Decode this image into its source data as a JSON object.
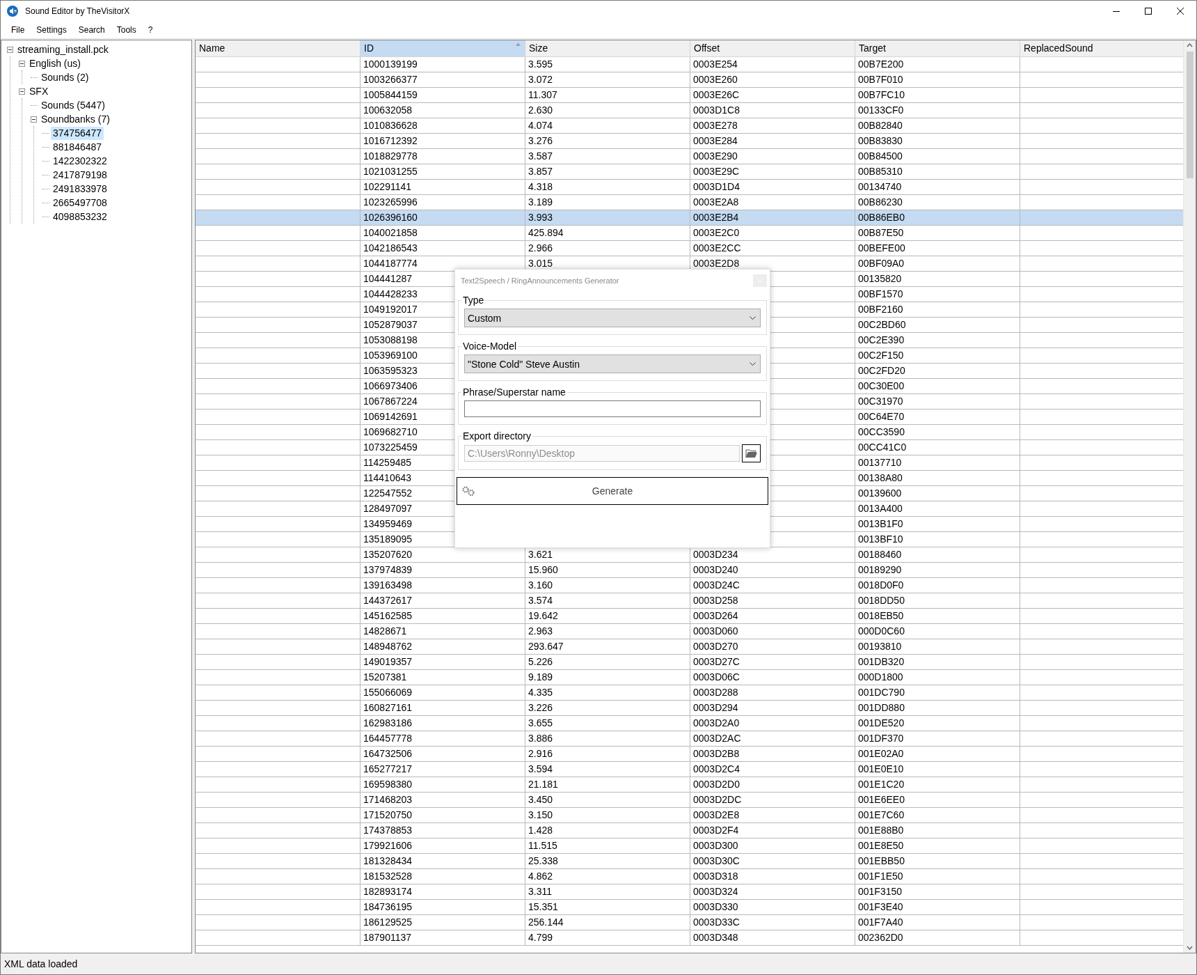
{
  "window": {
    "title": "Sound Editor by TheVisitorX"
  },
  "menu": [
    "File",
    "Settings",
    "Search",
    "Tools",
    "?"
  ],
  "tree": [
    {
      "label": "streaming_install.pck",
      "expanded": true,
      "selected": false,
      "children": [
        {
          "label": "English (us)",
          "expanded": true,
          "selected": false,
          "children": [
            {
              "label": "Sounds (2)",
              "selected": false
            }
          ]
        },
        {
          "label": "SFX",
          "expanded": true,
          "selected": false,
          "children": [
            {
              "label": "Sounds (5447)",
              "selected": false
            },
            {
              "label": "Soundbanks (7)",
              "expanded": true,
              "selected": false,
              "children": [
                {
                  "label": "374756477",
                  "selected": true
                },
                {
                  "label": "881846487",
                  "selected": false
                },
                {
                  "label": "1422302322",
                  "selected": false
                },
                {
                  "label": "2417879198",
                  "selected": false
                },
                {
                  "label": "2491833978",
                  "selected": false
                },
                {
                  "label": "2665497708",
                  "selected": false
                },
                {
                  "label": "4098853232",
                  "selected": false
                }
              ]
            }
          ]
        }
      ]
    }
  ],
  "table": {
    "columns": [
      {
        "label": "Name",
        "sorted": false
      },
      {
        "label": "ID",
        "sorted": true
      },
      {
        "label": "Size",
        "sorted": false
      },
      {
        "label": "Offset",
        "sorted": false
      },
      {
        "label": "Target",
        "sorted": false
      },
      {
        "label": "ReplacedSound",
        "sorted": false
      }
    ],
    "rows": [
      {
        "id": "1000139199",
        "size": "3.595",
        "offset": "0003E254",
        "target": "00B7E200",
        "selected": false
      },
      {
        "id": "1003266377",
        "size": "3.072",
        "offset": "0003E260",
        "target": "00B7F010",
        "selected": false
      },
      {
        "id": "1005844159",
        "size": "11.307",
        "offset": "0003E26C",
        "target": "00B7FC10",
        "selected": false
      },
      {
        "id": "100632058",
        "size": "2.630",
        "offset": "0003D1C8",
        "target": "00133CF0",
        "selected": false
      },
      {
        "id": "1010836628",
        "size": "4.074",
        "offset": "0003E278",
        "target": "00B82840",
        "selected": false
      },
      {
        "id": "1016712392",
        "size": "3.276",
        "offset": "0003E284",
        "target": "00B83830",
        "selected": false
      },
      {
        "id": "1018829778",
        "size": "3.587",
        "offset": "0003E290",
        "target": "00B84500",
        "selected": false
      },
      {
        "id": "1021031255",
        "size": "3.857",
        "offset": "0003E29C",
        "target": "00B85310",
        "selected": false
      },
      {
        "id": "102291141",
        "size": "4.318",
        "offset": "0003D1D4",
        "target": "00134740",
        "selected": false
      },
      {
        "id": "1023265996",
        "size": "3.189",
        "offset": "0003E2A8",
        "target": "00B86230",
        "selected": false
      },
      {
        "id": "1026396160",
        "size": "3.993",
        "offset": "0003E2B4",
        "target": "00B86EB0",
        "selected": true
      },
      {
        "id": "1040021858",
        "size": "425.894",
        "offset": "0003E2C0",
        "target": "00B87E50",
        "selected": false
      },
      {
        "id": "1042186543",
        "size": "2.966",
        "offset": "0003E2CC",
        "target": "00BEFE00",
        "selected": false
      },
      {
        "id": "1044187774",
        "size": "3.015",
        "offset": "0003E2D8",
        "target": "00BF09A0",
        "selected": false
      },
      {
        "id": "104441287",
        "target": "00135820",
        "selected": false
      },
      {
        "id": "1044428233",
        "target": "00BF1570",
        "selected": false
      },
      {
        "id": "1049192017",
        "target": "00BF2160",
        "selected": false
      },
      {
        "id": "1052879037",
        "target": "00C2BD60",
        "selected": false
      },
      {
        "id": "1053088198",
        "target": "00C2E390",
        "selected": false
      },
      {
        "id": "1053969100",
        "target": "00C2F150",
        "selected": false
      },
      {
        "id": "1063595323",
        "target": "00C2FD20",
        "selected": false
      },
      {
        "id": "1066973406",
        "target": "00C30E00",
        "selected": false
      },
      {
        "id": "1067867224",
        "target": "00C31970",
        "selected": false
      },
      {
        "id": "1069142691",
        "target": "00C64E70",
        "selected": false
      },
      {
        "id": "1069682710",
        "target": "00CC3590",
        "selected": false
      },
      {
        "id": "1073225459",
        "target": "00CC41C0",
        "selected": false
      },
      {
        "id": "114259485",
        "target": "00137710",
        "selected": false
      },
      {
        "id": "114410643",
        "target": "00138A80",
        "selected": false
      },
      {
        "id": "122547552",
        "target": "00139600",
        "selected": false
      },
      {
        "id": "128497097",
        "target": "0013A400",
        "selected": false
      },
      {
        "id": "134959469",
        "target": "0013B1F0",
        "selected": false
      },
      {
        "id": "135189095",
        "target": "0013BF10",
        "selected": false
      },
      {
        "id": "135207620",
        "size": "3.621",
        "offset": "0003D234",
        "target": "00188460",
        "selected": false
      },
      {
        "id": "137974839",
        "size": "15.960",
        "offset": "0003D240",
        "target": "00189290",
        "selected": false
      },
      {
        "id": "139163498",
        "size": "3.160",
        "offset": "0003D24C",
        "target": "0018D0F0",
        "selected": false
      },
      {
        "id": "144372617",
        "size": "3.574",
        "offset": "0003D258",
        "target": "0018DD50",
        "selected": false
      },
      {
        "id": "145162585",
        "size": "19.642",
        "offset": "0003D264",
        "target": "0018EB50",
        "selected": false
      },
      {
        "id": "14828671",
        "size": "2.963",
        "offset": "0003D060",
        "target": "000D0C60",
        "selected": false
      },
      {
        "id": "148948762",
        "size": "293.647",
        "offset": "0003D270",
        "target": "00193810",
        "selected": false
      },
      {
        "id": "149019357",
        "size": "5.226",
        "offset": "0003D27C",
        "target": "001DB320",
        "selected": false
      },
      {
        "id": "15207381",
        "size": "9.189",
        "offset": "0003D06C",
        "target": "000D1800",
        "selected": false
      },
      {
        "id": "155066069",
        "size": "4.335",
        "offset": "0003D288",
        "target": "001DC790",
        "selected": false
      },
      {
        "id": "160827161",
        "size": "3.226",
        "offset": "0003D294",
        "target": "001DD880",
        "selected": false
      },
      {
        "id": "162983186",
        "size": "3.655",
        "offset": "0003D2A0",
        "target": "001DE520",
        "selected": false
      },
      {
        "id": "164457778",
        "size": "3.886",
        "offset": "0003D2AC",
        "target": "001DF370",
        "selected": false
      },
      {
        "id": "164732506",
        "size": "2.916",
        "offset": "0003D2B8",
        "target": "001E02A0",
        "selected": false
      },
      {
        "id": "165277217",
        "size": "3.594",
        "offset": "0003D2C4",
        "target": "001E0E10",
        "selected": false
      },
      {
        "id": "169598380",
        "size": "21.181",
        "offset": "0003D2D0",
        "target": "001E1C20",
        "selected": false
      },
      {
        "id": "171468203",
        "size": "3.450",
        "offset": "0003D2DC",
        "target": "001E6EE0",
        "selected": false
      },
      {
        "id": "171520750",
        "size": "3.150",
        "offset": "0003D2E8",
        "target": "001E7C60",
        "selected": false
      },
      {
        "id": "174378853",
        "size": "1.428",
        "offset": "0003D2F4",
        "target": "001E88B0",
        "selected": false
      },
      {
        "id": "179921606",
        "size": "11.515",
        "offset": "0003D300",
        "target": "001E8E50",
        "selected": false
      },
      {
        "id": "181328434",
        "size": "25.338",
        "offset": "0003D30C",
        "target": "001EBB50",
        "selected": false
      },
      {
        "id": "181532528",
        "size": "4.862",
        "offset": "0003D318",
        "target": "001F1E50",
        "selected": false
      },
      {
        "id": "182893174",
        "size": "3.311",
        "offset": "0003D324",
        "target": "001F3150",
        "selected": false
      },
      {
        "id": "184736195",
        "size": "15.351",
        "offset": "0003D330",
        "target": "001F3E40",
        "selected": false
      },
      {
        "id": "186129525",
        "size": "256.144",
        "offset": "0003D33C",
        "target": "001F7A40",
        "selected": false
      },
      {
        "id": "187901137",
        "size": "4.799",
        "offset": "0003D348",
        "target": "002362D0",
        "selected": false
      }
    ]
  },
  "dialog": {
    "title": "Text2Speech / RingAnnouncements Generator",
    "type": {
      "label": "Type",
      "value": "Custom"
    },
    "voice_model": {
      "label": "Voice-Model",
      "value": "\"Stone Cold\" Steve Austin"
    },
    "phrase": {
      "label": "Phrase/Superstar name"
    },
    "export": {
      "label": "Export directory",
      "value": "C:\\Users\\Ronny\\Desktop",
      "disabled": true
    },
    "generate_button": "Generate"
  },
  "status_bar": "XML data loaded"
}
